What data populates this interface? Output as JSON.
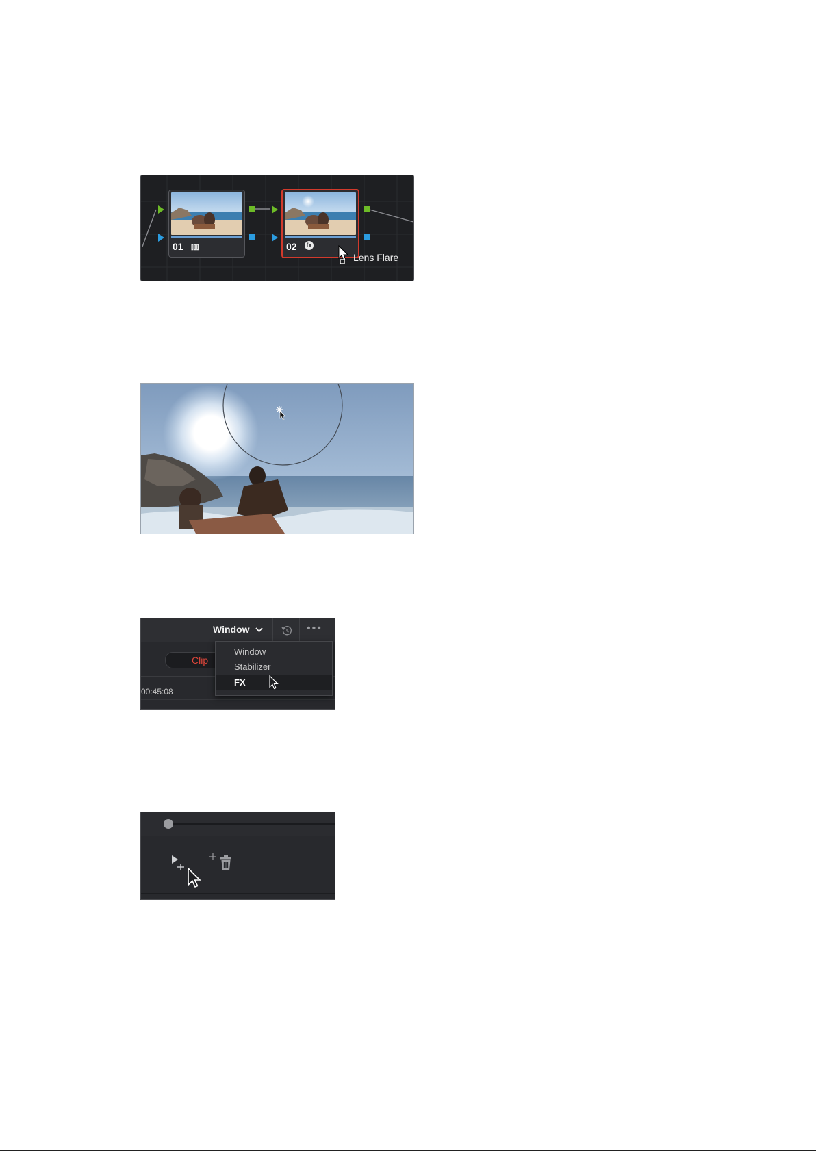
{
  "node_graph": {
    "nodes": [
      {
        "number": "01",
        "tool_icon": "bars-icon"
      },
      {
        "number": "02",
        "tool_icon": "fx-icon"
      }
    ],
    "tooltip": "Lens Flare",
    "colors": {
      "input_arrow": "#6dbb27",
      "key_arrow": "#2b9ce0",
      "selected_outline": "#d23a2c"
    }
  },
  "fx_menu": {
    "palette_button": "Window",
    "clip_tab": "Clip",
    "timecode": "00:45:08",
    "items": [
      "Window",
      "Stabilizer",
      "FX"
    ],
    "selected_item": "FX",
    "accent": "#e0463a"
  },
  "tools": {
    "pick_tool": "pick-fx-tool-icon",
    "delete_tool": "delete-fx-tool-icon"
  }
}
